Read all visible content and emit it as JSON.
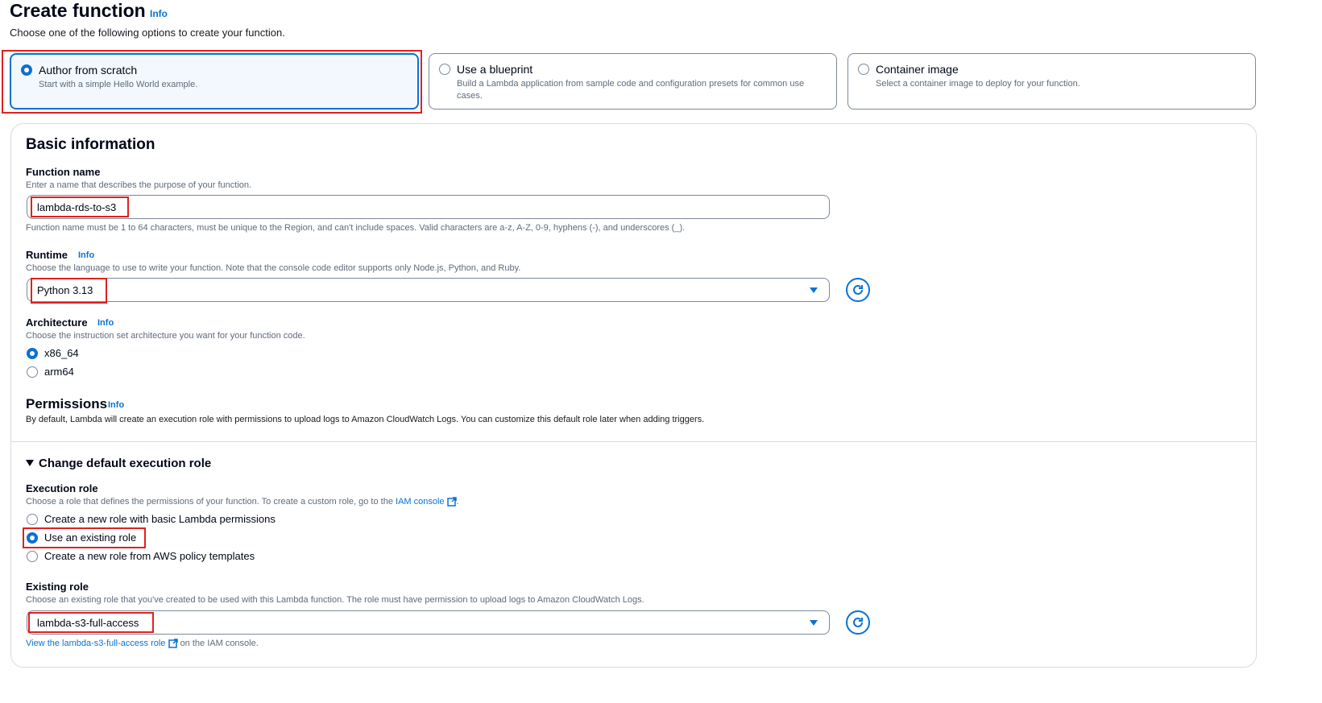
{
  "header": {
    "title": "Create function",
    "info": "Info",
    "subtitle": "Choose one of the following options to create your function."
  },
  "options": [
    {
      "title": "Author from scratch",
      "desc": "Start with a simple Hello World example.",
      "selected": true
    },
    {
      "title": "Use a blueprint",
      "desc": "Build a Lambda application from sample code and configuration presets for common use cases.",
      "selected": false
    },
    {
      "title": "Container image",
      "desc": "Select a container image to deploy for your function.",
      "selected": false
    }
  ],
  "basic": {
    "heading": "Basic information",
    "function_name": {
      "label": "Function name",
      "desc": "Enter a name that describes the purpose of your function.",
      "value": "lambda-rds-to-s3",
      "hint": "Function name must be 1 to 64 characters, must be unique to the Region, and can't include spaces. Valid characters are a-z, A-Z, 0-9, hyphens (-), and underscores (_)."
    },
    "runtime": {
      "label": "Runtime",
      "info": "Info",
      "desc": "Choose the language to use to write your function. Note that the console code editor supports only Node.js, Python, and Ruby.",
      "value": "Python 3.13"
    },
    "architecture": {
      "label": "Architecture",
      "info": "Info",
      "desc": "Choose the instruction set architecture you want for your function code.",
      "options": [
        "x86_64",
        "arm64"
      ],
      "selected": "x86_64"
    },
    "permissions": {
      "label": "Permissions",
      "info": "Info",
      "desc": "By default, Lambda will create an execution role with permissions to upload logs to Amazon CloudWatch Logs. You can customize this default role later when adding triggers."
    }
  },
  "role": {
    "expander": "Change default execution role",
    "exec_label": "Execution role",
    "exec_desc": "Choose a role that defines the permissions of your function. To create a custom role, go to the",
    "iam_link": "IAM console",
    "exec_desc_end": ".",
    "options": [
      "Create a new role with basic Lambda permissions",
      "Use an existing role",
      "Create a new role from AWS policy templates"
    ],
    "selected": "Use an existing role",
    "existing_label": "Existing role",
    "existing_desc": "Choose an existing role that you've created to be used with this Lambda function. The role must have permission to upload logs to Amazon CloudWatch Logs.",
    "existing_value": "lambda-s3-full-access",
    "view_link": "View the lambda-s3-full-access role",
    "view_suffix": "on the IAM console."
  },
  "colors": {
    "accent": "#0972d3",
    "highlight": "#e02020"
  }
}
